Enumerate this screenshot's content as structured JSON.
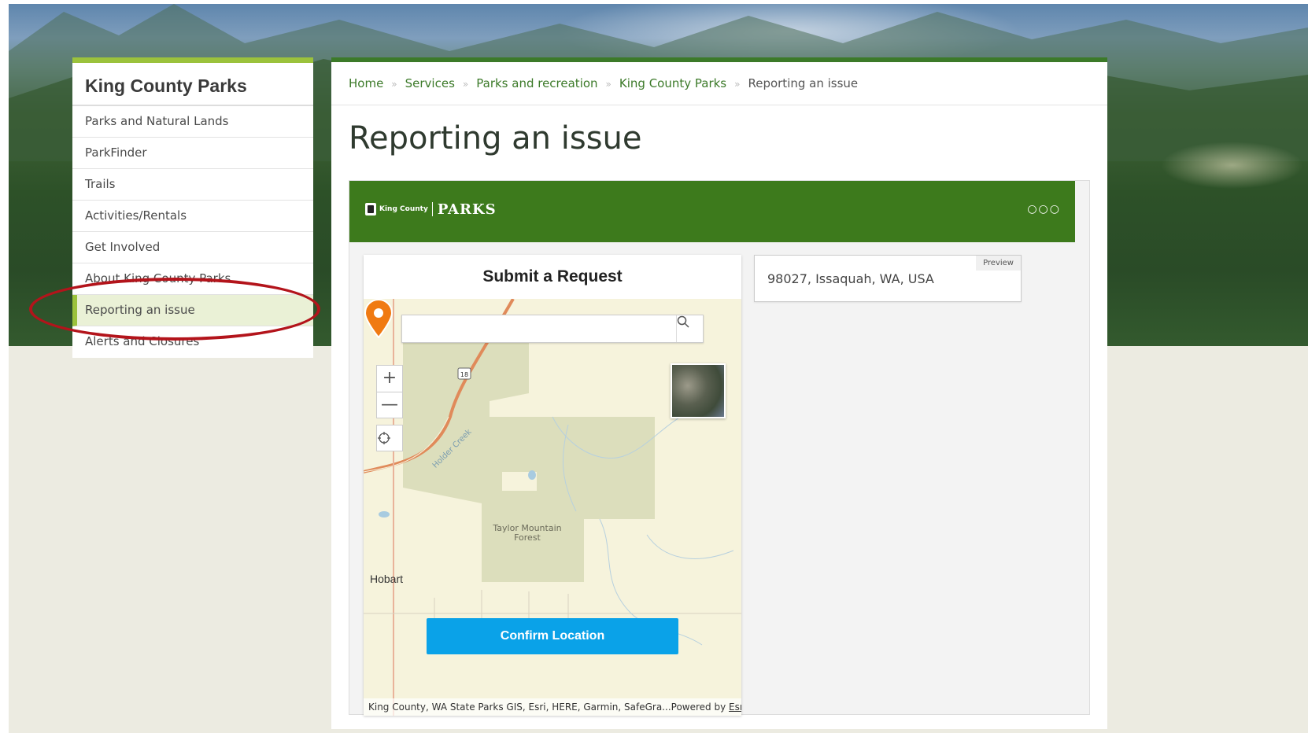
{
  "sidebar": {
    "title": "King County Parks",
    "items": [
      {
        "label": "Parks and Natural Lands"
      },
      {
        "label": "ParkFinder"
      },
      {
        "label": "Trails"
      },
      {
        "label": "Activities/Rentals"
      },
      {
        "label": "Get Involved"
      },
      {
        "label": "About King County Parks"
      },
      {
        "label": "Reporting an issue",
        "active": true
      },
      {
        "label": "Alerts and Closures"
      }
    ]
  },
  "breadcrumb": [
    "Home",
    "Services",
    "Parks and recreation",
    "King County Parks",
    "Reporting an issue"
  ],
  "page_title": "Reporting an issue",
  "app": {
    "logo_small": "King County",
    "logo_brand": "PARKS",
    "more_icon": "more-horizontal-icon",
    "card_title": "Submit a Request",
    "search_placeholder": "",
    "search_icon": "search-icon",
    "zoom_in_label": "+",
    "zoom_out_label": "—",
    "locate_icon": "crosshair-icon",
    "map_labels": {
      "forest": "Taylor Mountain Forest",
      "town": "Hobart",
      "creek": "Holder Creek",
      "route": "18"
    },
    "confirm_button": "Confirm Location",
    "attribution": "King County, WA State Parks GIS, Esri, HERE, Garmin, SafeGra...",
    "powered_by": "Powered by",
    "powered_by_link": "Esri",
    "preview_address": "98027, Issaquah, WA, USA",
    "preview_tag": "Preview"
  },
  "colors": {
    "brand_green": "#3d7a1c",
    "accent_lime": "#9bc23c",
    "button_blue": "#0aa2e8",
    "pin_orange": "#f07a12",
    "annotation_red": "#b3141b"
  }
}
